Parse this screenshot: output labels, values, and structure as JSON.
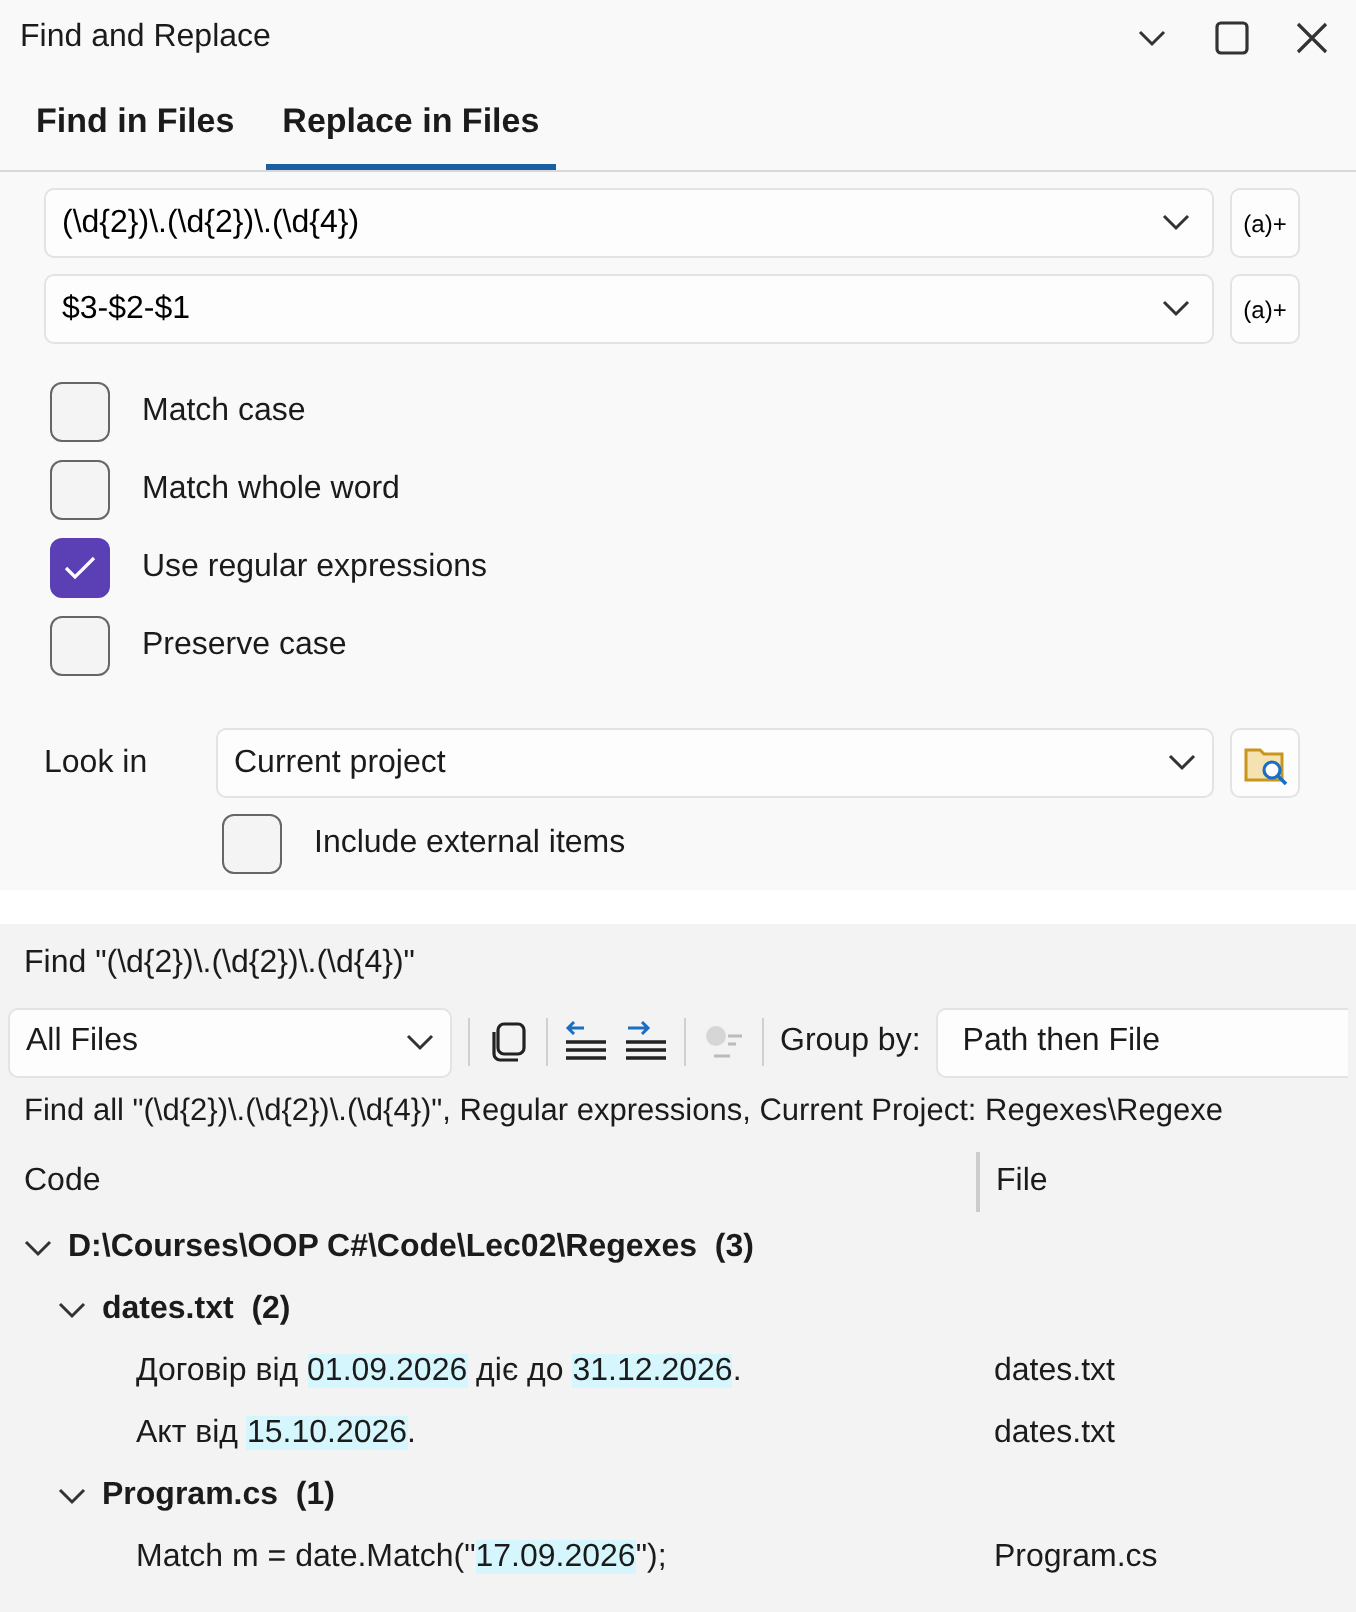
{
  "window": {
    "title": "Find and Replace"
  },
  "tabs": [
    {
      "label": "Find in Files",
      "selected": false
    },
    {
      "label": "Replace in Files",
      "selected": true
    }
  ],
  "find_field": {
    "value": "(\\d{2})\\.(\\d{2})\\.(\\d{4})",
    "builder_button": "(a)+"
  },
  "replace_field": {
    "value": "$3-$2-$1",
    "builder_button": "(a)+"
  },
  "options": [
    {
      "label": "Match case",
      "checked": false
    },
    {
      "label": "Match whole word",
      "checked": false
    },
    {
      "label": "Use regular expressions",
      "checked": true
    },
    {
      "label": "Preserve case",
      "checked": false
    }
  ],
  "look_in": {
    "label": "Look in",
    "value": "Current project"
  },
  "include_external": {
    "label": "Include external items",
    "checked": false
  },
  "results": {
    "title": "Find \"(\\d{2})\\.(\\d{2})\\.(\\d{4})\"",
    "scope": "All Files",
    "group_by": {
      "label": "Group by:",
      "value": "Path then File"
    },
    "summary": "Find all \"(\\d{2})\\.(\\d{2})\\.(\\d{4})\", Regular expressions, Current Project: Regexes\\Regexe",
    "columns": [
      "Code",
      "File"
    ],
    "tree": [
      {
        "label": "D:\\Courses\\OOP C#\\Code\\Lec02\\Regexes",
        "count": "(3)",
        "expanded": true,
        "children": [
          {
            "label": "dates.txt",
            "count": "(2)",
            "expanded": true,
            "children": [
              {
                "segments": [
                  {
                    "text": "Договір від ",
                    "match": false
                  },
                  {
                    "text": "01.09.2026",
                    "match": true
                  },
                  {
                    "text": " діє до ",
                    "match": false
                  },
                  {
                    "text": "31.12.2026",
                    "match": true
                  },
                  {
                    "text": ".",
                    "match": false
                  }
                ],
                "file": "dates.txt"
              },
              {
                "segments": [
                  {
                    "text": "Акт від ",
                    "match": false
                  },
                  {
                    "text": "15.10.2026",
                    "match": true
                  },
                  {
                    "text": ".",
                    "match": false
                  }
                ],
                "file": "dates.txt"
              }
            ]
          },
          {
            "label": "Program.cs",
            "count": "(1)",
            "expanded": true,
            "children": [
              {
                "segments": [
                  {
                    "text": "Match m = date.Match(\"",
                    "match": false
                  },
                  {
                    "text": "17.09.2026",
                    "match": true
                  },
                  {
                    "text": "\");",
                    "match": false
                  }
                ],
                "file": "Program.cs"
              }
            ]
          }
        ]
      }
    ]
  }
}
